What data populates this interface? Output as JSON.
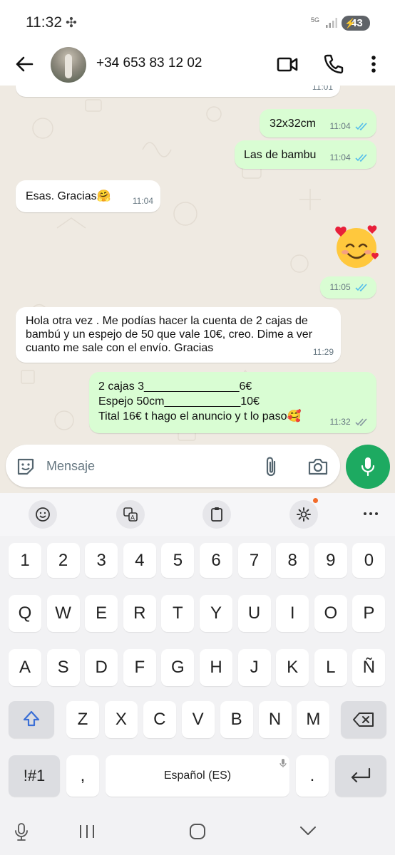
{
  "status_bar": {
    "time": "11:32",
    "network": "5G",
    "battery": "43"
  },
  "header": {
    "contact": "+34 653 83 12 02"
  },
  "messages": [
    {
      "text": "32x32cm",
      "time": "11:04",
      "direction": "out",
      "read": true
    },
    {
      "text": "Las de bambu",
      "time": "11:04",
      "direction": "out",
      "read": true
    },
    {
      "text": "Esas. Gracias🤗",
      "time": "11:04",
      "direction": "in"
    },
    {
      "text": "",
      "time": "11:05",
      "direction": "out",
      "read": true,
      "sticker": "smiling-face-with-hearts"
    },
    {
      "line1": "Hola otra vez . Me podías hacer la cuenta de 2 cajas de",
      "line2": "bambú y un espejo de 50 que vale 10€, creo. Dime  a ver",
      "line3": "cuanto me sale con el envío. Gracias",
      "time": "11:29",
      "direction": "in"
    },
    {
      "line1": "2 cajas 3_______________6€",
      "line2": "Espejo 50cm____________10€",
      "line3": "Tital 16€ t hago el anuncio  y t lo paso🥰",
      "time": "11:32",
      "direction": "out",
      "read": false
    }
  ],
  "partial_top_time": "11:01",
  "input": {
    "placeholder": "Mensaje"
  },
  "keyboard": {
    "row_numbers": [
      "1",
      "2",
      "3",
      "4",
      "5",
      "6",
      "7",
      "8",
      "9",
      "0"
    ],
    "row1": [
      "Q",
      "W",
      "E",
      "R",
      "T",
      "Y",
      "U",
      "I",
      "O",
      "P"
    ],
    "row2": [
      "A",
      "S",
      "D",
      "F",
      "G",
      "H",
      "J",
      "K",
      "L",
      "Ñ"
    ],
    "row3": [
      "Z",
      "X",
      "C",
      "V",
      "B",
      "N",
      "M"
    ],
    "symbols_key": "!#1",
    "comma": ",",
    "space": "Español (ES)",
    "period": "."
  },
  "colors": {
    "chat_bg": "#efeae2",
    "outgoing_bubble": "#d9fdd3",
    "incoming_bubble": "#ffffff",
    "read_ticks": "#53bdeb",
    "mic_button": "#1daa61",
    "shift_active": "#3b6fd6"
  }
}
